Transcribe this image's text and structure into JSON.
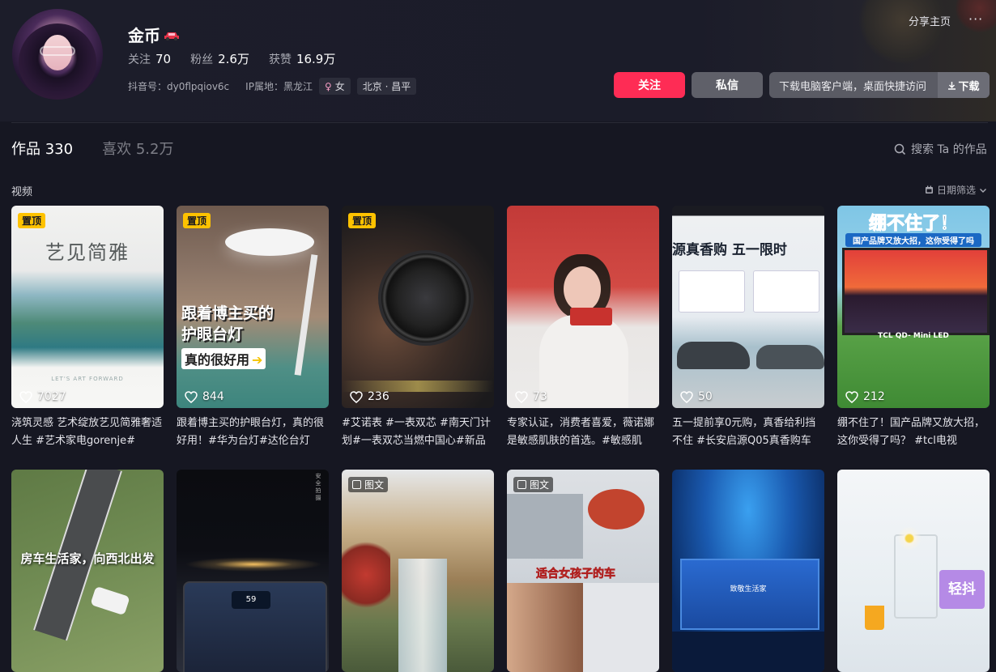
{
  "profile": {
    "name": "金币",
    "stats": {
      "following_label": "关注",
      "following": "70",
      "followers_label": "粉丝",
      "followers": "2.6万",
      "likes_label": "获赞",
      "likes": "16.9万"
    },
    "douyin_id": "抖音号：dy0flpqiov6c",
    "ip_location": "IP属地：黑龙江",
    "gender": "女",
    "region": "北京 · 昌平"
  },
  "header_actions": {
    "share": "分享主页",
    "more": "···",
    "follow": "关注",
    "message": "私信",
    "download_prompt": "下载电脑客户端，桌面快捷访问",
    "download": "下载"
  },
  "tabs": {
    "works_label": "作品",
    "works_count": "330",
    "likes_label": "喜欢",
    "likes_count": "5.2万"
  },
  "search": {
    "placeholder": "搜索 Ta 的作品"
  },
  "section": {
    "label": "视频",
    "filter": "日期筛选"
  },
  "colors": {
    "accent": "#fe2c55",
    "pin_badge": "#fec200",
    "background": "#161722"
  },
  "videos": [
    {
      "pinned": true,
      "badge": "置顶",
      "likes": "7027",
      "caption": "浇筑灵感 艺术绽放艺见简雅奢适人生 #艺术家电gorenje#",
      "thumb_title": "艺见简雅",
      "thumb_sub": "LET'S ART FORWARD"
    },
    {
      "pinned": true,
      "badge": "置顶",
      "likes": "844",
      "caption": "跟着博主买的护眼台灯，真的很好用！#华为台灯#达伦台灯",
      "thumb_title1": "跟着博主买的",
      "thumb_title2": "护眼台灯",
      "thumb_title3": "真的很好用"
    },
    {
      "pinned": true,
      "badge": "置顶",
      "likes": "236",
      "caption": "#艾诺表 #一表双芯 #南天门计划#一表双芯当燃中国心#新品"
    },
    {
      "pinned": false,
      "likes": "73",
      "caption": "专家认证，消费者喜爱，薇诺娜是敏感肌肤的首选。#敏感肌"
    },
    {
      "pinned": false,
      "likes": "50",
      "caption": "五一提前享0元购，真香给利挡不住 #长安启源Q05真香购车",
      "thumb_title": "源真香购  五一限时"
    },
    {
      "pinned": false,
      "likes": "212",
      "caption": "绷不住了！国产品牌又放大招，这你受得了吗？ #tcl电视",
      "thumb_title": "绷不住了！",
      "thumb_sub": "国产品牌又放大招，这你受得了吗",
      "thumb_brand": "TCL QD- Mini LED"
    },
    {
      "pinned": false,
      "likes": "",
      "caption": "",
      "thumb_title": "房车生活家，向西北出发"
    },
    {
      "pinned": false,
      "likes": "",
      "caption": "",
      "thumb_sub": "安全拍摄"
    },
    {
      "pinned": false,
      "type": "图文",
      "likes": "",
      "caption": ""
    },
    {
      "pinned": false,
      "type": "图文",
      "likes": "",
      "caption": "",
      "thumb_title": "适合女孩子的车"
    },
    {
      "pinned": false,
      "likes": "",
      "caption": "",
      "thumb_title": "致敬生活家"
    },
    {
      "pinned": false,
      "likes": "",
      "caption": "",
      "thumb_brand": "轻抖"
    }
  ]
}
